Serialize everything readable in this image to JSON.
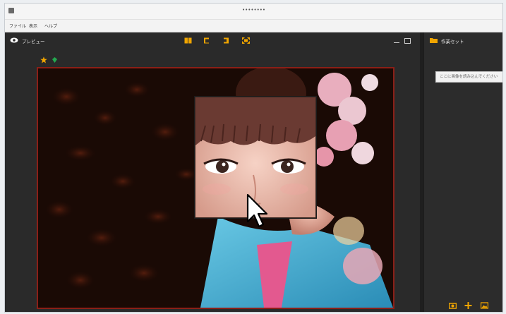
{
  "window": {
    "title": "••••••••"
  },
  "menu": {
    "items": [
      "ファイル",
      "表示",
      "ヘルプ"
    ]
  },
  "left_pane": {
    "title": "プレビュー"
  },
  "right_pane": {
    "title": "作業セット",
    "hint": "ここに画像を読み込んでください"
  },
  "icons": {
    "eye": "eye-icon",
    "book": "book-icon",
    "rotate_left": "rotate-left-icon",
    "rotate_right": "rotate-right-icon",
    "fit": "fit-icon",
    "star": "star-icon",
    "gem": "gem-icon",
    "folder": "folder-icon",
    "camera": "camera-icon",
    "plus": "plus-icon",
    "image": "image-icon"
  },
  "colors": {
    "accent": "#f0a500",
    "stage_border": "#8b1f17"
  }
}
